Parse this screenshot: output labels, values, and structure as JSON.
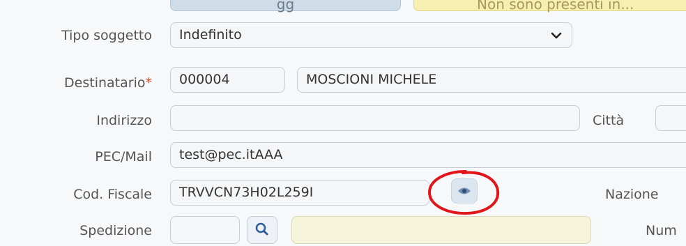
{
  "top": {
    "button_label": "gg",
    "warning_text": "Non sono presenti in..."
  },
  "form": {
    "tipo_soggetto": {
      "label": "Tipo soggetto",
      "value": "Indefinito"
    },
    "destinatario": {
      "label": "Destinatario",
      "required_mark": "*",
      "code": "000004",
      "name": "MOSCIONI MICHELE"
    },
    "indirizzo": {
      "label": "Indirizzo",
      "value": ""
    },
    "citta": {
      "label": "Città",
      "value": ""
    },
    "pec_mail": {
      "label": "PEC/Mail",
      "value": "test@pec.itAAA"
    },
    "cod_fiscale": {
      "label": "Cod. Fiscale",
      "value": "TRVVCN73H02L259I"
    },
    "nazione": {
      "label": "Nazione"
    },
    "spedizione": {
      "label": "Spedizione",
      "code": "",
      "description": ""
    },
    "numero": {
      "label": "Num"
    }
  },
  "icons": {
    "select_arrow": "chevron-down-icon",
    "view": "eye-icon",
    "search": "search-icon"
  },
  "colors": {
    "required": "#e2401c",
    "annotation": "#e0161b",
    "field_bg": "#f4f6f8",
    "readonly_yellow": "#f5f3d9"
  }
}
